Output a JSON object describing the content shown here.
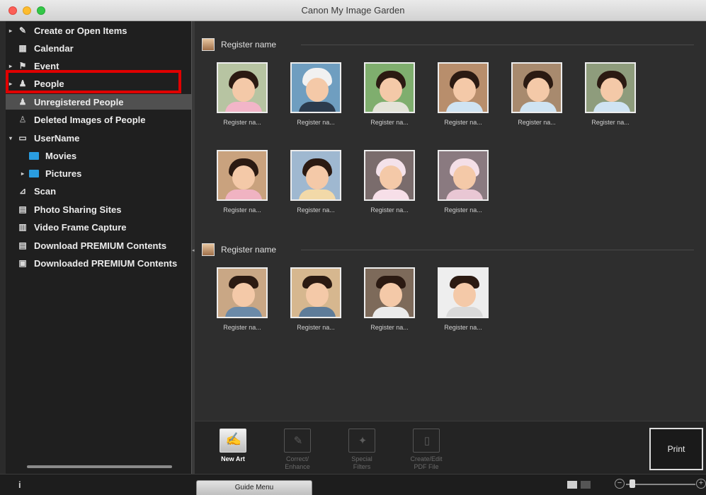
{
  "window": {
    "title": "Canon My Image Garden"
  },
  "sidebar": {
    "items": [
      {
        "label": "Create or Open Items",
        "icon": "create-items-icon",
        "arrow": "▸"
      },
      {
        "label": "Calendar",
        "icon": "calendar-icon",
        "arrow": ""
      },
      {
        "label": "Event",
        "icon": "event-icon",
        "arrow": "▸"
      },
      {
        "label": "People",
        "icon": "people-icon",
        "arrow": "▸"
      },
      {
        "label": "Unregistered People",
        "icon": "unregistered-person-icon",
        "arrow": ""
      },
      {
        "label": "Deleted Images of People",
        "icon": "deleted-person-icon",
        "arrow": ""
      },
      {
        "label": "UserName",
        "icon": "computer-icon",
        "arrow": "▾"
      },
      {
        "label": "Movies",
        "icon": "folder-icon",
        "arrow": ""
      },
      {
        "label": "Pictures",
        "icon": "folder-icon",
        "arrow": "▸"
      },
      {
        "label": "Scan",
        "icon": "scan-icon",
        "arrow": ""
      },
      {
        "label": "Photo Sharing Sites",
        "icon": "photo-sharing-icon",
        "arrow": ""
      },
      {
        "label": "Video Frame Capture",
        "icon": "video-frame-icon",
        "arrow": ""
      },
      {
        "label": "Download PREMIUM Contents",
        "icon": "download-contents-icon",
        "arrow": ""
      },
      {
        "label": "Downloaded PREMIUM Contents",
        "icon": "downloaded-contents-icon",
        "arrow": ""
      }
    ],
    "selected": "Unregistered People"
  },
  "groups": [
    {
      "title": "Register name",
      "thumbs": [
        "Register na...",
        "Register na...",
        "Register na...",
        "Register na...",
        "Register na...",
        "Register na...",
        "Register na...",
        "Register na...",
        "Register na...",
        "Register na..."
      ]
    },
    {
      "title": "Register name",
      "thumbs": [
        "Register na...",
        "Register na...",
        "Register na...",
        "Register na..."
      ]
    }
  ],
  "toolbar": {
    "new_art": "New Art",
    "correct_line1": "Correct/",
    "correct_line2": "Enhance",
    "special_line1": "Special",
    "special_line2": "Filters",
    "pdf_line1": "Create/Edit",
    "pdf_line2": "PDF File",
    "print": "Print"
  },
  "statusbar": {
    "guide_menu": "Guide Menu",
    "info_icon": "i",
    "zoom_level": 0.05
  },
  "colors": {
    "selection_frame": "#e00000",
    "sidebar_bg": "#1f1f1f",
    "main_bg": "#2e2e2e"
  }
}
